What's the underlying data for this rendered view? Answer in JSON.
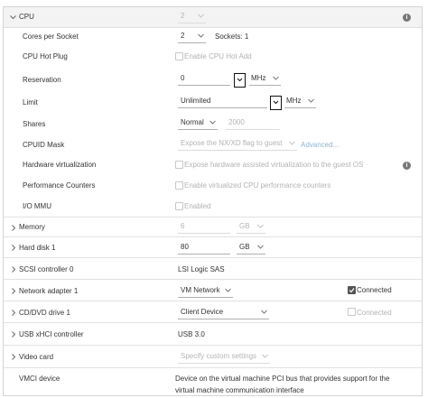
{
  "cpu": {
    "header": "CPU",
    "value": "2",
    "cores_per_socket": {
      "label": "Cores per Socket",
      "value": "2",
      "sockets": "Sockets: 1"
    },
    "hot_plug": {
      "label": "CPU Hot Plug",
      "option": "Enable CPU Hot Add"
    },
    "reservation": {
      "label": "Reservation",
      "value": "0",
      "unit": "MHz"
    },
    "limit": {
      "label": "Limit",
      "value": "Unlimited",
      "unit": "MHz"
    },
    "shares": {
      "label": "Shares",
      "value": "Normal",
      "amount": "2000"
    },
    "cpuid_mask": {
      "label": "CPUID Mask",
      "value": "Expose the NX/XD flag to guest",
      "link": "Advanced..."
    },
    "hw_virt": {
      "label": "Hardware virtualization",
      "option": "Expose hardware assisted virtualization to the guest OS"
    },
    "perf_counters": {
      "label": "Performance Counters",
      "option": "Enable virtualized CPU performance counters"
    },
    "iommu": {
      "label": "I/O MMU",
      "option": "Enabled"
    }
  },
  "memory": {
    "label": "Memory",
    "value": "6",
    "unit": "GB"
  },
  "hard_disk": {
    "label": "Hard disk 1",
    "value": "80",
    "unit": "GB"
  },
  "scsi": {
    "label": "SCSI controller 0",
    "value": "LSI Logic SAS"
  },
  "network": {
    "label": "Network adapter 1",
    "value": "VM Network",
    "connected": "Connected",
    "connected_checked": true
  },
  "cdrom": {
    "label": "CD/DVD drive 1",
    "value": "Client Device",
    "connected": "Connected",
    "connected_checked": false
  },
  "usb": {
    "label": "USB xHCI controller",
    "value": "USB 3.0"
  },
  "video": {
    "label": "Video card",
    "value": "Specify custom settings"
  },
  "vmci": {
    "label": "VMCI device",
    "line1": "Device on the virtual machine PCI bus that provides support for the",
    "line2": "virtual machine communication interface"
  },
  "icons": [
    "chevron-down-icon",
    "chevron-right-icon",
    "info-icon",
    "dropdown-arrow-icon",
    "checkbox-icon"
  ]
}
